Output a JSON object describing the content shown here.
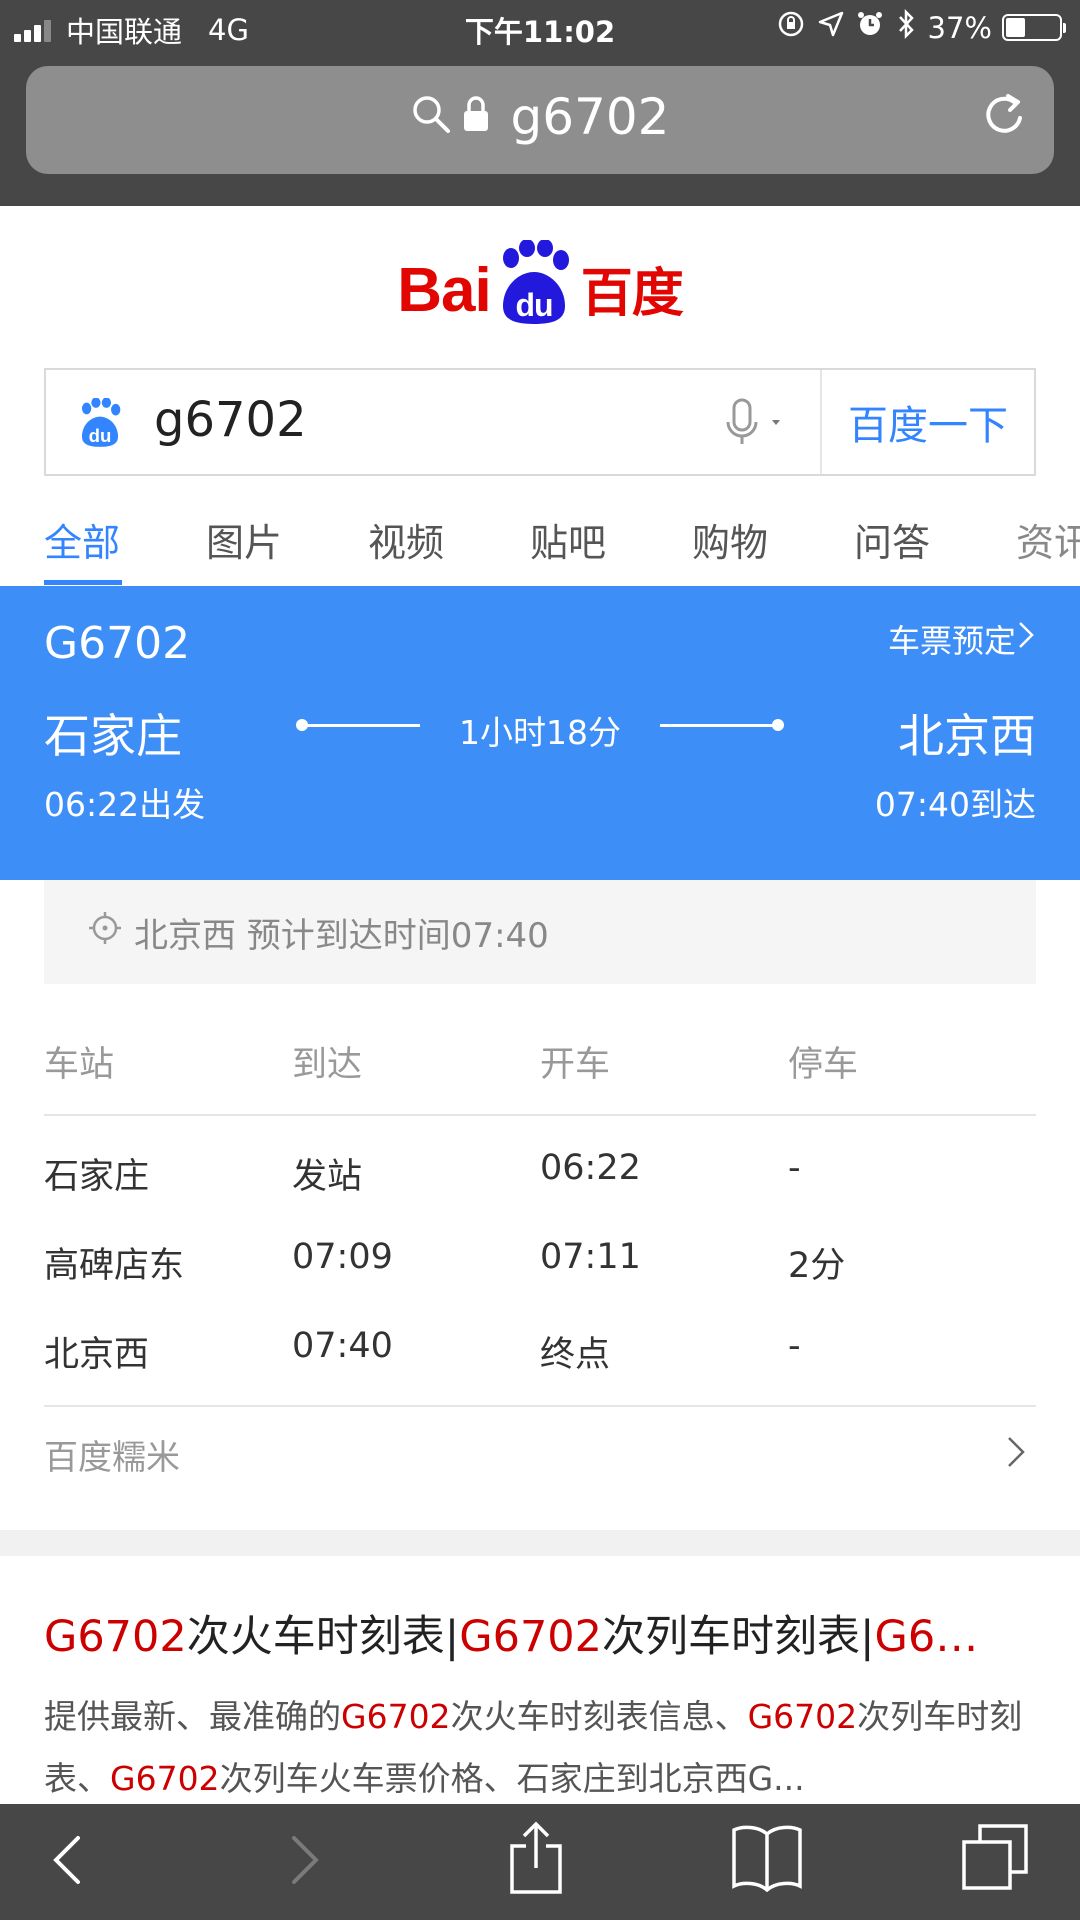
{
  "status_bar": {
    "carrier": "中国联通",
    "network": "4G",
    "time": "下午11:02",
    "battery": "37%",
    "battery_level": 0.37
  },
  "url_bar": {
    "query": "g6702"
  },
  "logo": {
    "text_left": "Bai",
    "text_paw": "du",
    "text_cn": "百度"
  },
  "search": {
    "value": "g6702",
    "button_label": "百度一下"
  },
  "tabs": [
    {
      "label": "全部",
      "active": true
    },
    {
      "label": "图片"
    },
    {
      "label": "视频"
    },
    {
      "label": "贴吧"
    },
    {
      "label": "购物"
    },
    {
      "label": "问答"
    },
    {
      "label": "资讯"
    }
  ],
  "train": {
    "number": "G6702",
    "ticket_link": "车票预定",
    "from_station": "石家庄",
    "to_station": "北京西",
    "departure": "06:22出发",
    "arrival": "07:40到达",
    "duration": "1小时18分"
  },
  "info": {
    "text": "北京西 预计到达时间07:40"
  },
  "schedule": {
    "headers": [
      "车站",
      "到达",
      "开车",
      "停车"
    ],
    "rows": [
      [
        "石家庄",
        "发站",
        "06:22",
        "-"
      ],
      [
        "高碑店东",
        "07:09",
        "07:11",
        "2分"
      ],
      [
        "北京西",
        "07:40",
        "终点",
        "-"
      ]
    ]
  },
  "source": {
    "label": "百度糯米"
  },
  "result": {
    "title_parts": [
      {
        "text": "G6702",
        "hl": true
      },
      {
        "text": "次火车时刻表|"
      },
      {
        "text": "G6702",
        "hl": true
      },
      {
        "text": "次列车时刻表|"
      },
      {
        "text": "G6…",
        "hl": true
      }
    ],
    "desc_parts": [
      {
        "text": "提供最新、最准确的"
      },
      {
        "text": "G6702",
        "hl": true
      },
      {
        "text": "次火车时刻表信息、"
      },
      {
        "text": "G6702",
        "hl": true
      },
      {
        "text": "次列车时刻表、"
      },
      {
        "text": "G6702",
        "hl": true
      },
      {
        "text": "次列车火车票价格、石家庄到北京西G..."
      }
    ]
  },
  "colors": {
    "accent": "#3385ff",
    "card": "#3e8ef7",
    "highlight": "#cc0000",
    "brand": "#e10601"
  }
}
